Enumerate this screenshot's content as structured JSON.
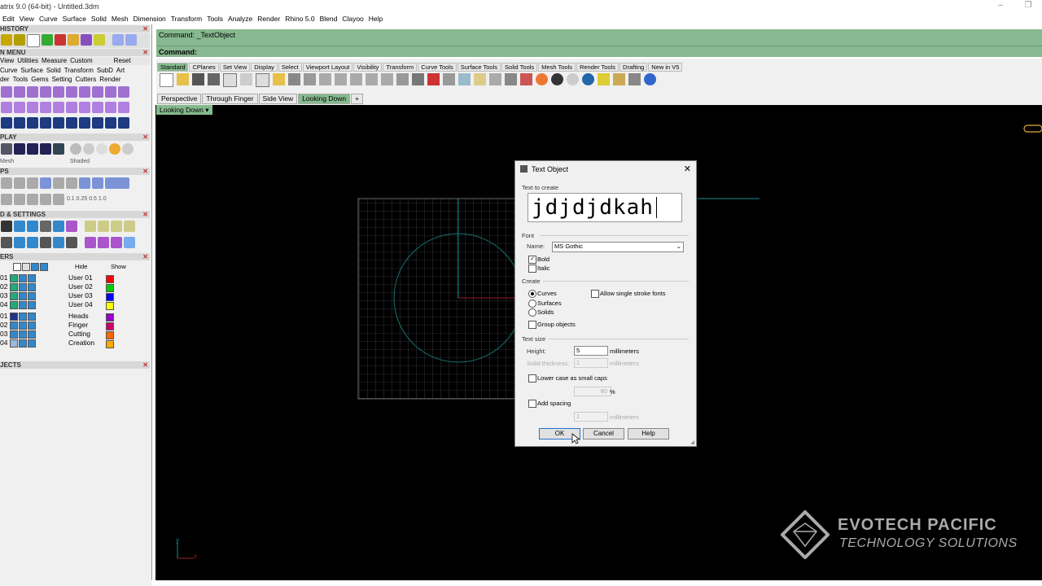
{
  "window": {
    "title": "atrix 9.0 (64-bit) - Untitled.3dm",
    "min": "–",
    "restore": "❐"
  },
  "menu": [
    "Edit",
    "View",
    "Curve",
    "Surface",
    "Solid",
    "Mesh",
    "Dimension",
    "Transform",
    "Tools",
    "Analyze",
    "Render",
    "Rhino 5.0",
    "Blend",
    "Clayoo",
    "Help"
  ],
  "left": {
    "history_header": "HISTORY",
    "menu_header": "N MENU",
    "menu_tabs": [
      "View",
      "Utilities",
      "Measure",
      "Custom"
    ],
    "menu_reset": "Reset",
    "menu_items_row1": [
      "Curve",
      "Surface",
      "Solid",
      "Transform",
      "SubD",
      "Art"
    ],
    "menu_items_row2": [
      "der",
      "Tools",
      "Gems",
      "Setting",
      "Cutters",
      "Render"
    ],
    "display_header": "PLAY",
    "display_mode1": "Mesh",
    "display_mode2": "Shaded",
    "snaps_header": "PS",
    "snap_vals": [
      "0.1",
      "0.25",
      "0.5",
      "1.0"
    ],
    "settings_header": "D & SETTINGS",
    "layers_header": "ERS",
    "hide_label": "Hide",
    "show_label": "Show",
    "objects_header": "JECTS",
    "layers": [
      {
        "id": "01",
        "name": "User 01",
        "color": "#ff0000"
      },
      {
        "id": "02",
        "name": "User 02",
        "color": "#00cc00"
      },
      {
        "id": "03",
        "name": "User 03",
        "color": "#0000ff"
      },
      {
        "id": "04",
        "name": "User 04",
        "color": "#ffff00"
      }
    ],
    "layers2": [
      {
        "id": "01",
        "name": "Heads",
        "color": "#9900cc"
      },
      {
        "id": "02",
        "name": "Finger",
        "color": "#cc0066"
      },
      {
        "id": "03",
        "name": "Cutting",
        "color": "#ff6600"
      },
      {
        "id": "04",
        "name": "Creation",
        "color": "#ffaa00"
      }
    ]
  },
  "command": {
    "line1": "Command: _TextObject",
    "line2": "Command:"
  },
  "toolbar_tabs": [
    "Standard",
    "CPlanes",
    "Set View",
    "Display",
    "Select",
    "Viewport Layout",
    "Visibility",
    "Transform",
    "Curve Tools",
    "Surface Tools",
    "Solid Tools",
    "Mesh Tools",
    "Render Tools",
    "Drafting",
    "New in V5"
  ],
  "viewport_tabs": [
    "Perspective",
    "Through Finger",
    "Side View",
    "Looking Down"
  ],
  "viewport_add": "+",
  "viewport_label": "Looking Down",
  "dialog": {
    "title": "Text Object",
    "close": "✕",
    "text_to_create_label": "Text to create",
    "text_value": "jdjdjdkah",
    "font_label": "Font",
    "name_label": "Name:",
    "font_name": "MS Gothic",
    "bold": "Bold",
    "italic": "Italic",
    "create_label": "Create",
    "curves": "Curves",
    "surfaces": "Surfaces",
    "solids": "Solids",
    "allow_single": "Allow single stroke fonts",
    "group_objects": "Group objects",
    "text_size_label": "Text size",
    "height_label": "Height:",
    "height_value": "5",
    "height_unit": "millimeters",
    "solid_thickness_label": "Solid thickness:",
    "solid_thickness_value": "1",
    "solid_unit": "millimeters",
    "lower_case": "Lower case as small caps",
    "small_caps_value": "80",
    "percent": "%",
    "add_spacing": "Add spacing",
    "spacing_value": "1",
    "spacing_unit": "millimeters",
    "ok": "OK",
    "cancel": "Cancel",
    "help": "Help"
  },
  "watermark": {
    "line1": "EVOTECH PACIFIC",
    "line2": "TECHNOLOGY SOLUTIONS"
  },
  "axis": {
    "y": "y",
    "x": "x"
  }
}
